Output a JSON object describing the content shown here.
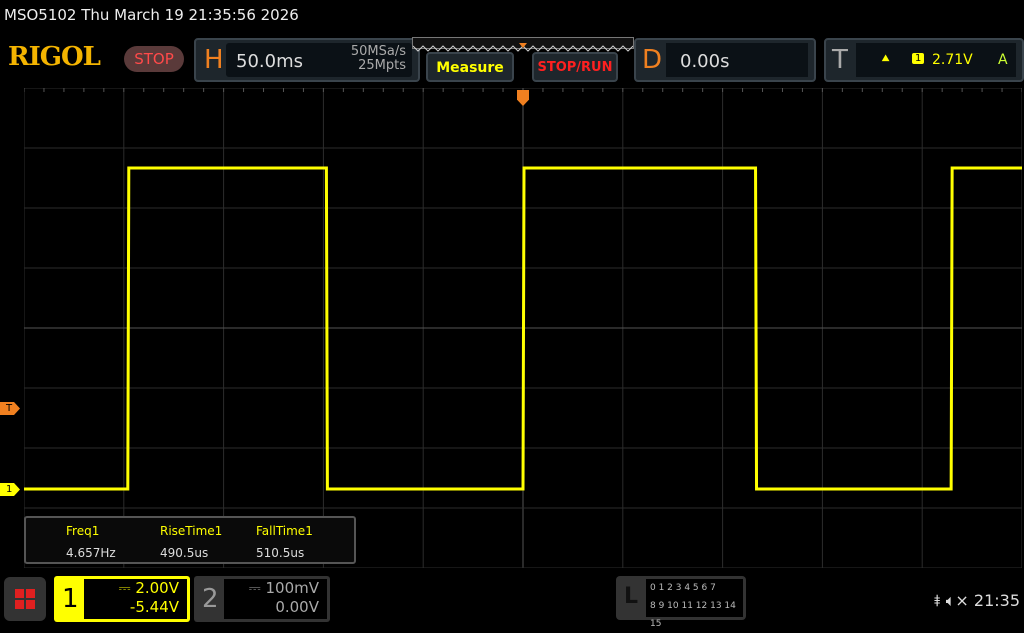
{
  "title": "MSO5102  Thu March 19 21:35:56 2026",
  "logo": "RIGOL",
  "run_state": "STOP",
  "horizontal": {
    "letter": "H",
    "timebase": "50.0ms",
    "sample_rate": "50MSa/s",
    "memory_depth": "25Mpts"
  },
  "buttons": {
    "measure": "Measure",
    "stop_run": "STOP/RUN"
  },
  "delay": {
    "letter": "D",
    "value": "0.00s"
  },
  "trigger": {
    "letter": "T",
    "slope_icon": "rising-edge-icon",
    "source": "1",
    "level": "2.71V",
    "mode": "A"
  },
  "markers": {
    "trigger": "T",
    "channel1": "1"
  },
  "measurements": [
    {
      "label": "Freq1",
      "value": "4.657Hz"
    },
    {
      "label": "RiseTime1",
      "value": "490.5us"
    },
    {
      "label": "FallTime1",
      "value": "510.5us"
    }
  ],
  "channel1": {
    "num": "1",
    "scale": "2.00V",
    "offset": "-5.44V",
    "color": "#ffff00"
  },
  "channel2": {
    "num": "2",
    "scale": "100mV",
    "offset": "0.00V"
  },
  "logic": {
    "letter": "L",
    "row1": "0 1 2 3  4 5 6 7",
    "row2": "8 9 10 11 12 13 14 15"
  },
  "status": {
    "usb": "usb-icon",
    "mute": "speaker-muted-icon",
    "time": "21:35"
  },
  "chart_data": {
    "type": "line",
    "time_per_div_ms": 50,
    "volts_per_div": 2,
    "xlim_ms": [
      -250,
      250
    ],
    "low_v": 0,
    "high_v": 10.7,
    "edges_ms": [
      {
        "t": -198,
        "dir": "rise"
      },
      {
        "t": -98.5,
        "dir": "fall"
      },
      {
        "t": 0,
        "dir": "rise"
      },
      {
        "t": 116.5,
        "dir": "fall"
      },
      {
        "t": 214.5,
        "dir": "rise"
      }
    ],
    "initial_state": "low",
    "grid": true
  }
}
